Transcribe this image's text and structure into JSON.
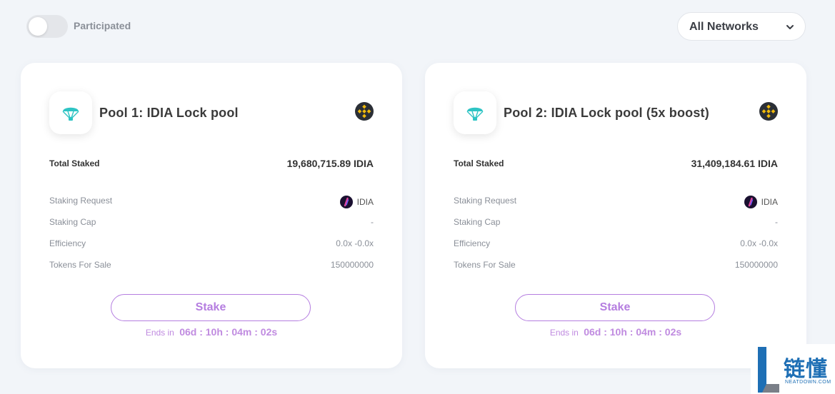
{
  "filters": {
    "participated_label": "Participated",
    "participated_on": false,
    "network_selected": "All Networks"
  },
  "pools": [
    {
      "title": "Pool 1: IDIA Lock pool",
      "chain_icon": "bnb-chain-icon",
      "total_staked_label": "Total Staked",
      "total_staked_value": "19,680,715.89 IDIA",
      "staking_request_label": "Staking Request",
      "staking_request_token": "IDIA",
      "staking_cap_label": "Staking Cap",
      "staking_cap_value": "-",
      "efficiency_label": "Efficiency",
      "efficiency_value": "0.0x -0.0x",
      "tokens_for_sale_label": "Tokens For Sale",
      "tokens_for_sale_value": "150000000",
      "stake_label": "Stake",
      "ends_label": "Ends in",
      "ends_timer": "06d : 10h : 04m : 02s"
    },
    {
      "title": "Pool 2: IDIA Lock pool (5x boost)",
      "chain_icon": "bnb-chain-icon",
      "total_staked_label": "Total Staked",
      "total_staked_value": "31,409,184.61 IDIA",
      "staking_request_label": "Staking Request",
      "staking_request_token": "IDIA",
      "staking_cap_label": "Staking Cap",
      "staking_cap_value": "-",
      "efficiency_label": "Efficiency",
      "efficiency_value": "0.0x -0.0x",
      "tokens_for_sale_label": "Tokens For Sale",
      "tokens_for_sale_value": "150000000",
      "stake_label": "Stake",
      "ends_label": "Ends in",
      "ends_timer": "06d : 10h : 04m : 02s"
    }
  ],
  "colors": {
    "accent": "#b57ee0",
    "timer": "#c08be0",
    "pool_icon": "#2ec4c4",
    "bnb_yellow": "#f0b90b",
    "bnb_dark": "#2b2f36"
  },
  "watermark": {
    "cn": "链懂",
    "en": "NEATDOWN.COM"
  }
}
